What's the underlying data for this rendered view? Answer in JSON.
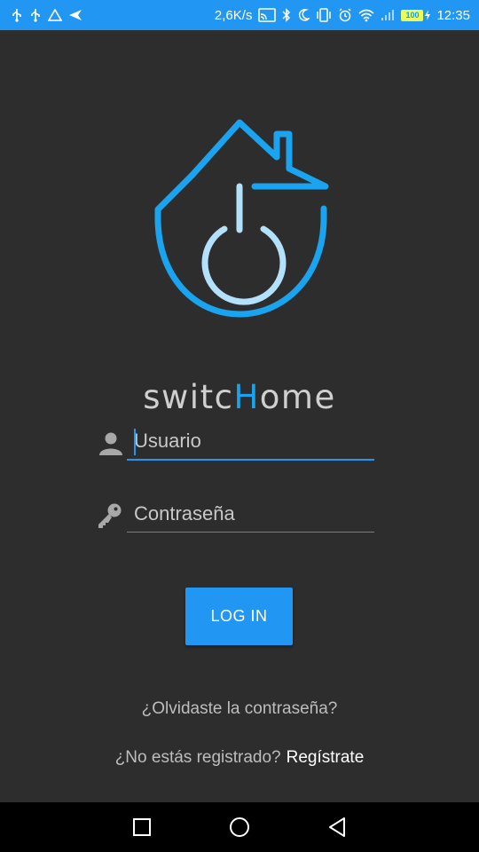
{
  "status_bar": {
    "speed": "2,6K/s",
    "battery": "100",
    "time": "12:35",
    "icons_left": [
      "usb-icon",
      "usb-icon",
      "alert-icon",
      "send-icon"
    ],
    "icons_right": [
      "cast-icon",
      "bluetooth-icon",
      "moon-icon",
      "vibrate-icon",
      "alarm-icon",
      "wifi-icon",
      "signal-icon",
      "battery-icon",
      "charging-icon"
    ]
  },
  "app": {
    "name_part1": "switc",
    "name_accent": "H",
    "name_part2": "ome",
    "accent_color": "#1aa3ee",
    "logo_light_color": "#b3e0fb"
  },
  "login": {
    "username_placeholder": "Usuario",
    "password_placeholder": "Contraseña",
    "login_label": "LOG IN",
    "forgot_label": "¿Olvidaste la contraseña?",
    "register_question": "¿No estás registrado?",
    "register_link": "Regístrate"
  },
  "nav_bar": {
    "icons": [
      "recents-icon",
      "home-icon",
      "back-icon"
    ]
  }
}
